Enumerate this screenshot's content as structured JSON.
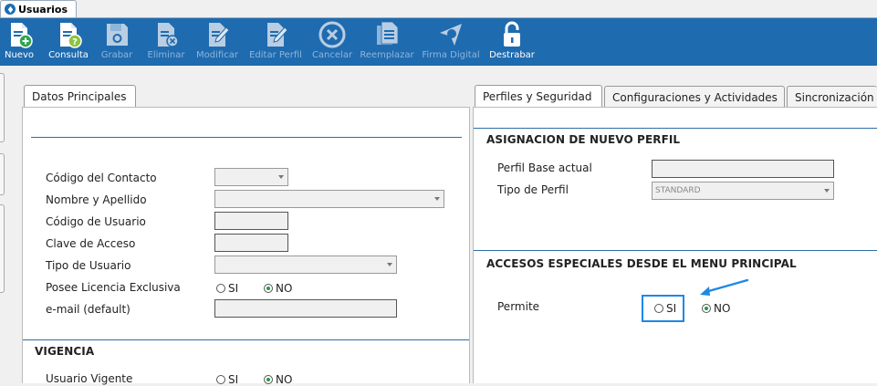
{
  "window_tab": {
    "label": "Usuarios"
  },
  "toolbar": {
    "buttons": [
      {
        "label": "Nuevo",
        "icon": "new-document-icon",
        "enabled": true
      },
      {
        "label": "Consulta",
        "icon": "query-document-icon",
        "enabled": true
      },
      {
        "label": "Grabar",
        "icon": "save-disk-icon",
        "enabled": false
      },
      {
        "label": "Eliminar",
        "icon": "delete-document-icon",
        "enabled": false
      },
      {
        "label": "Modificar",
        "icon": "edit-document-icon",
        "enabled": false
      },
      {
        "label": "Editar Perfil",
        "icon": "edit-profile-icon",
        "enabled": false
      },
      {
        "label": "Cancelar",
        "icon": "cancel-circle-icon",
        "enabled": false
      },
      {
        "label": "Reemplazar",
        "icon": "replace-documents-icon",
        "enabled": false
      },
      {
        "label": "Firma Digital",
        "icon": "digital-signature-icon",
        "enabled": false
      },
      {
        "label": "Destrabar",
        "icon": "unlock-padlock-icon",
        "enabled": true
      }
    ]
  },
  "left_panel": {
    "tab": "Datos Principales",
    "fields": {
      "codigo_contacto": "Código del Contacto",
      "nombre_apellido": "Nombre y Apellido",
      "codigo_usuario": "Código de Usuario",
      "clave_acceso": "Clave de Acceso",
      "tipo_usuario": "Tipo de Usuario",
      "licencia_exclusiva": "Posee Licencia Exclusiva",
      "email": "e-mail (default)"
    },
    "licencia_si": "SI",
    "licencia_no": "NO",
    "vigencia": {
      "title": "VIGENCIA",
      "usuario_vigente": "Usuario Vigente",
      "si": "SI",
      "no": "NO"
    }
  },
  "right_panel": {
    "tabs": [
      "Perfiles y Seguridad",
      "Configuraciones y Actividades",
      "Sincronización"
    ],
    "asignacion": {
      "title": "ASIGNACION DE NUEVO PERFIL",
      "perfil_base": "Perfil Base actual",
      "tipo_perfil": "Tipo de Perfil",
      "tipo_perfil_value": "STANDARD"
    },
    "accesos": {
      "title": "ACCESOS ESPECIALES DESDE EL MENU PRINCIPAL",
      "permite": "Permite",
      "si": "SI",
      "no": "NO"
    }
  },
  "colors": {
    "toolbar": "#1f6bb0",
    "accent": "#1e88e5",
    "section_line": "#2e6da4"
  }
}
